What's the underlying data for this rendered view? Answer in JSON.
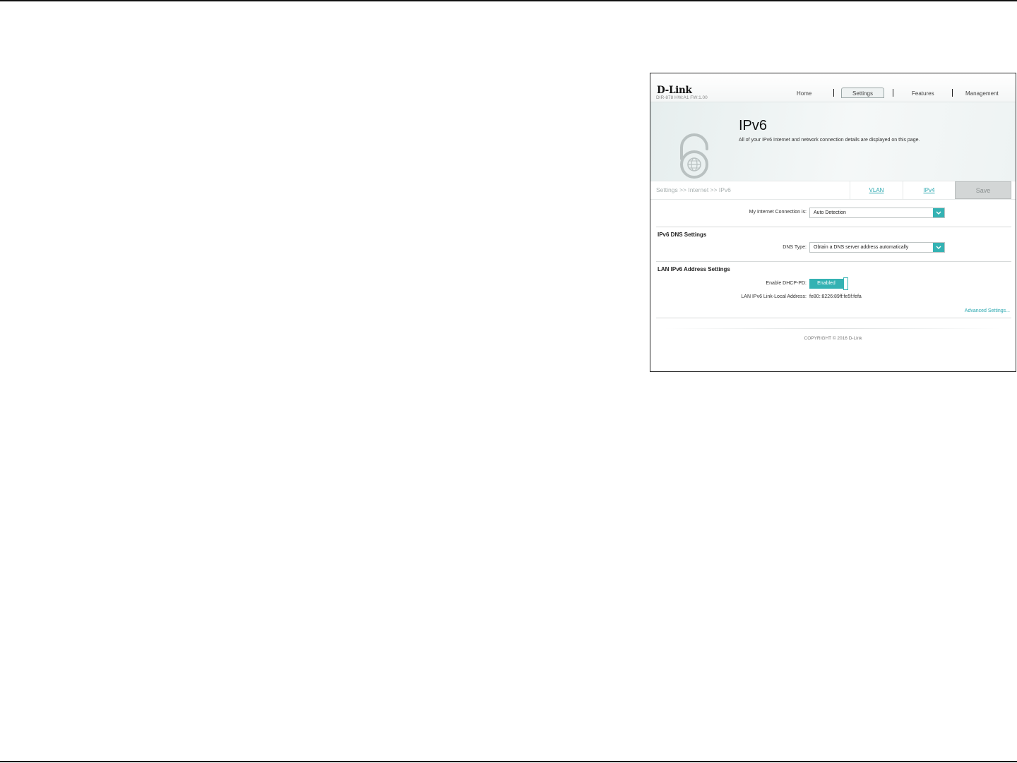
{
  "header": {
    "logo": "D-Link",
    "model": "DIR-878 HW:A1 FW:1.00",
    "nav": {
      "home": "Home",
      "settings": "Settings",
      "features": "Features",
      "management": "Management"
    }
  },
  "banner": {
    "title": "IPv6",
    "description": "All of your IPv6 Internet and network connection details are displayed on this page.",
    "icon": "globe-lock-icon"
  },
  "breadcrumb": {
    "path": "Settings >> Internet >> IPv6",
    "tabs": {
      "vlan": "VLAN",
      "ipv4": "IPv4"
    },
    "save_label": "Save"
  },
  "connection": {
    "label": "My Internet Connection is:",
    "value": "Auto Detection"
  },
  "dns": {
    "section_title": "IPv6 DNS Settings",
    "label": "DNS Type:",
    "value": "Obtain a DNS server address automatically"
  },
  "lan": {
    "section_title": "LAN IPv6 Address Settings",
    "dhcp_pd_label": "Enable DHCP-PD:",
    "dhcp_pd_value": "Enabled",
    "link_local_label": "LAN IPv6 Link-Local Address:",
    "link_local_value": "fe80::8226:89ff:fe5f:fefa",
    "advanced_link": "Advanced Settings..."
  },
  "footer": {
    "copyright": "COPYRIGHT © 2016 D-Link"
  },
  "colors": {
    "accent": "#34b2b3",
    "link": "#2ba8b0",
    "save_disabled": "#d3d6d6"
  }
}
